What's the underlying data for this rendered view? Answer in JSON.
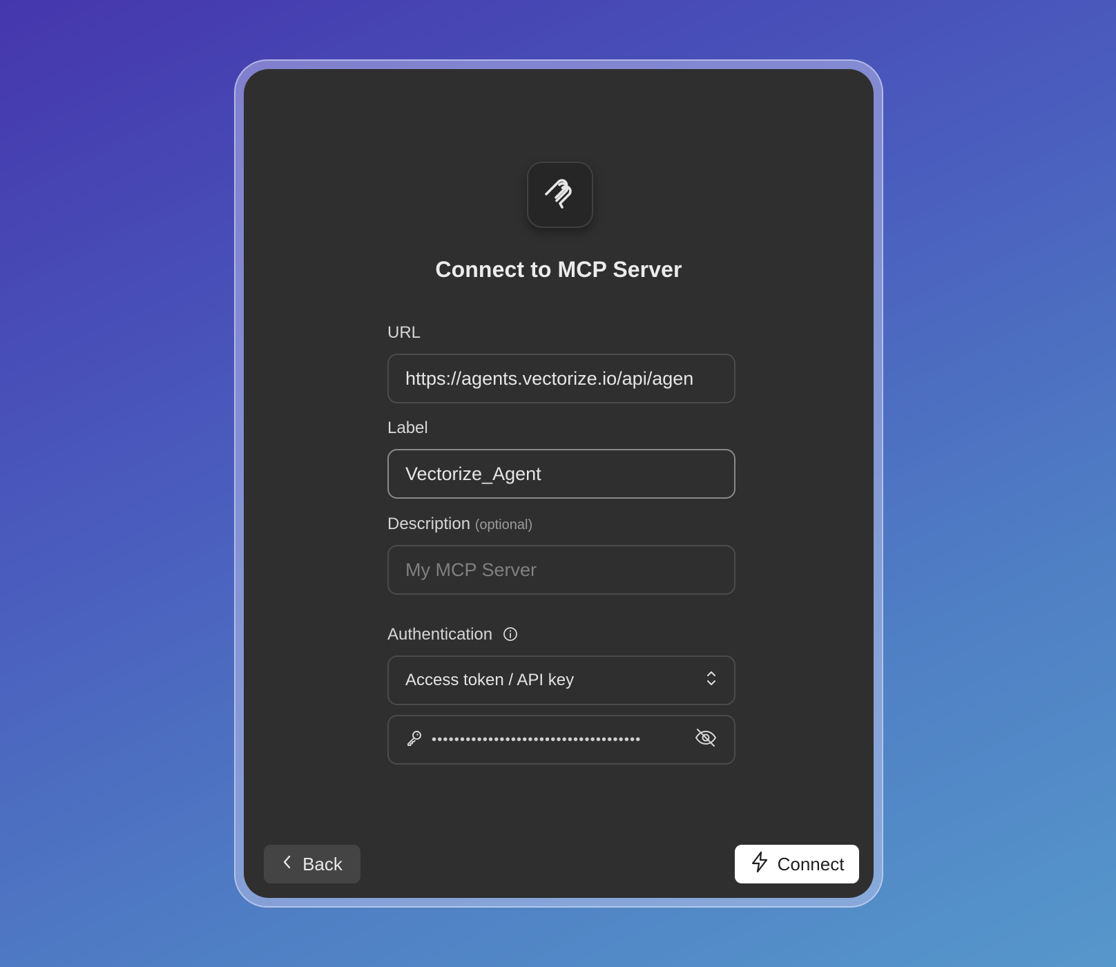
{
  "dialog": {
    "title": "Connect to MCP Server",
    "icon": "mcp-logo-icon"
  },
  "form": {
    "url": {
      "label": "URL",
      "value": "https://agents.vectorize.io/api/agen"
    },
    "label_field": {
      "label": "Label",
      "value": "Vectorize_Agent"
    },
    "description": {
      "label": "Description",
      "optional_note": "(optional)",
      "placeholder": "My MCP Server"
    },
    "authentication": {
      "label": "Authentication",
      "selected": "Access token / API key",
      "token_masked": "•••••••••••••••••••••••••••••••••••••",
      "icons": [
        "info-icon",
        "chevron-up-down-icon",
        "key-icon",
        "eye-off-icon"
      ]
    }
  },
  "footer": {
    "back_label": "Back",
    "connect_label": "Connect"
  },
  "colors": {
    "card_bg": "#2f2f2f",
    "connect_bg": "#ffffff",
    "back_bg": "#444444",
    "gradient_start": "#4536ad",
    "gradient_end": "#5697cb"
  }
}
